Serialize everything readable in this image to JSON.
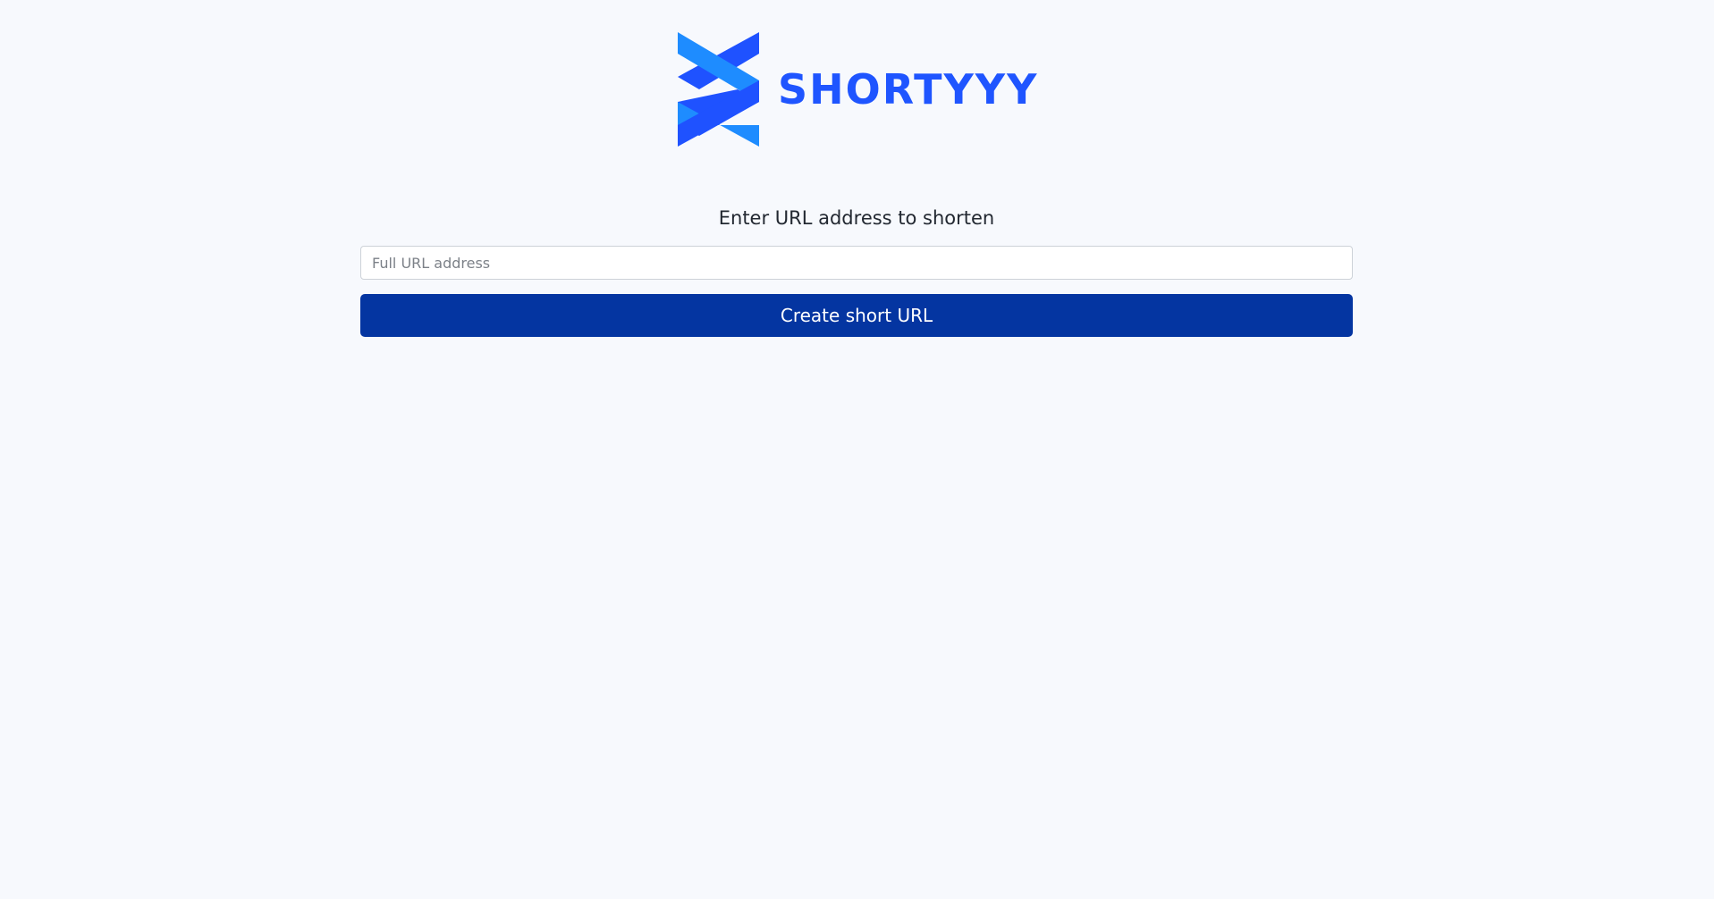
{
  "brand": {
    "name": "SHORTYYY",
    "color": "#1f55ff",
    "logo_icon": "crossed-ribbons-logo-icon",
    "logo_light": "#1e8cff",
    "logo_dark": "#1f52ff"
  },
  "form": {
    "heading": "Enter URL address to shorten",
    "input_placeholder": "Full URL address",
    "input_value": "",
    "submit_label": "Create short URL",
    "submit_color": "#0435a1"
  }
}
